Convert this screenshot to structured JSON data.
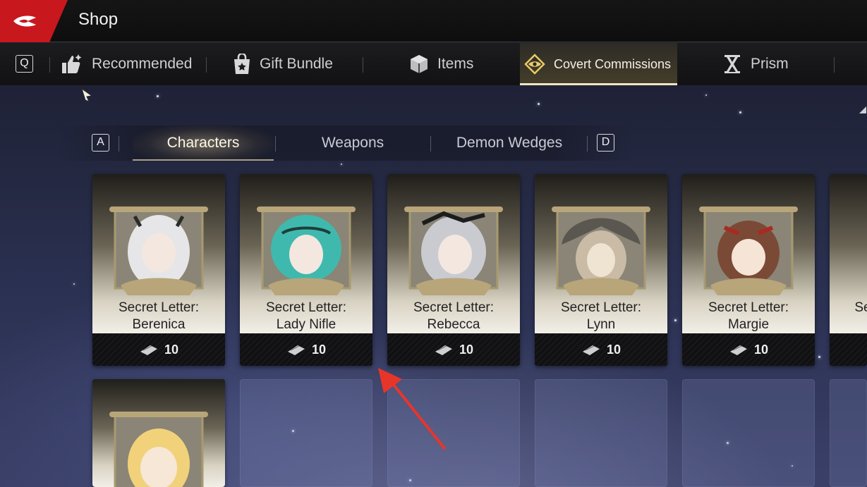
{
  "header": {
    "title": "Shop"
  },
  "tabs": {
    "left_key": "Q",
    "items": [
      {
        "label": "Recommended",
        "icon": "thumbs-up-icon"
      },
      {
        "label": "Gift Bundle",
        "icon": "gift-bag-icon"
      },
      {
        "label": "Items",
        "icon": "box-icon"
      },
      {
        "label": "Covert Commissions",
        "icon": "eye-diamond-icon",
        "active": true
      },
      {
        "label": "Prism",
        "icon": "hourglass-icon"
      }
    ]
  },
  "subtabs": {
    "left_key": "A",
    "right_key": "D",
    "items": [
      {
        "label": "Characters",
        "active": true
      },
      {
        "label": "Weapons"
      },
      {
        "label": "Demon Wedges"
      }
    ]
  },
  "cards": [
    {
      "line1": "Secret Letter:",
      "line2": "Berenica",
      "price": "10",
      "hair": "#e6e6e8"
    },
    {
      "line1": "Secret Letter:",
      "line2": "Lady Nifle",
      "price": "10",
      "hair": "#3fb9ad"
    },
    {
      "line1": "Secret Letter:",
      "line2": "Rebecca",
      "price": "10",
      "hair": "#c9cbd0"
    },
    {
      "line1": "Secret Letter:",
      "line2": "Lynn",
      "price": "10",
      "hair": "#5a5650"
    },
    {
      "line1": "Secret Letter:",
      "line2": "Margie",
      "price": "10",
      "hair": "#7a4a36"
    },
    {
      "line1": "Se",
      "line2": "",
      "price": "",
      "hair": "#d8cfb6"
    }
  ],
  "second_row": {
    "first_card_hair": "#f1d27a"
  },
  "colors": {
    "accent_red": "#c8171d",
    "active_tab_underline": "#efe4c4",
    "annotation_arrow": "#e8352a"
  }
}
